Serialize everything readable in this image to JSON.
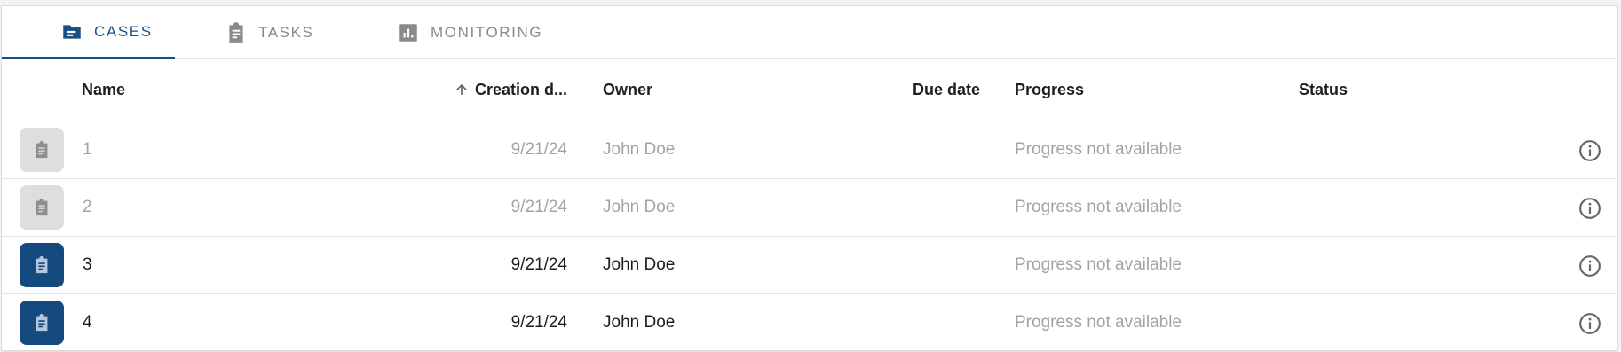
{
  "tabs": [
    {
      "label": "CASES",
      "icon": "folder-icon",
      "active": true
    },
    {
      "label": "TASKS",
      "icon": "clipboard-icon",
      "active": false
    },
    {
      "label": "MONITORING",
      "icon": "bar-chart-icon",
      "active": false
    }
  ],
  "table": {
    "columns": {
      "name": "Name",
      "creation_date": "Creation d...",
      "owner": "Owner",
      "due_date": "Due date",
      "progress": "Progress",
      "status": "Status"
    },
    "sort": {
      "column": "creation_date",
      "direction": "ascending",
      "icon": "arrow-up-icon"
    },
    "rows": [
      {
        "name": "1",
        "creation_date": "9/21/24",
        "owner": "John Doe",
        "due_date": "",
        "progress": "Progress not available",
        "status": "",
        "enabled": false
      },
      {
        "name": "2",
        "creation_date": "9/21/24",
        "owner": "John Doe",
        "due_date": "",
        "progress": "Progress not available",
        "status": "",
        "enabled": false
      },
      {
        "name": "3",
        "creation_date": "9/21/24",
        "owner": "John Doe",
        "due_date": "",
        "progress": "Progress not available",
        "status": "",
        "enabled": true
      },
      {
        "name": "4",
        "creation_date": "9/21/24",
        "owner": "John Doe",
        "due_date": "",
        "progress": "Progress not available",
        "status": "",
        "enabled": true
      }
    ]
  },
  "colors": {
    "accent": "#1a4f86",
    "badge_active": "#154a7e",
    "badge_inactive": "#dedede",
    "muted_text": "#a3a3a3"
  }
}
